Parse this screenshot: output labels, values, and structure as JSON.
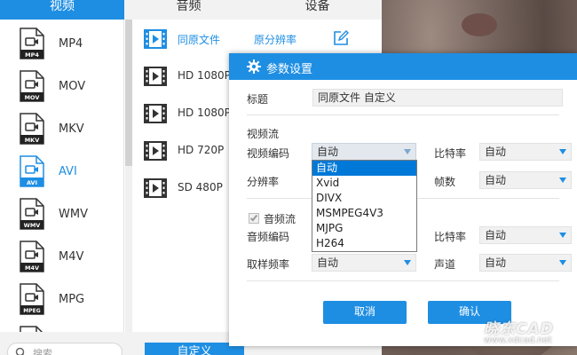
{
  "tabs": [
    {
      "label": "视频"
    },
    {
      "label": "音频"
    },
    {
      "label": "设备"
    }
  ],
  "formats": [
    {
      "label": "MP4",
      "badge": "MP4"
    },
    {
      "label": "MOV",
      "badge": "MOV"
    },
    {
      "label": "MKV",
      "badge": "MKV"
    },
    {
      "label": "AVI",
      "badge": "AVI"
    },
    {
      "label": "WMV",
      "badge": "WMV"
    },
    {
      "label": "M4V",
      "badge": "M4V"
    },
    {
      "label": "MPG",
      "badge": "MPEG"
    }
  ],
  "selected_format": "AVI",
  "resolutions": [
    {
      "name": "同原文件",
      "quality": "原分辨率"
    },
    {
      "name": "HD 1080P",
      "quality": ""
    },
    {
      "name": "HD 1080P",
      "quality": ""
    },
    {
      "name": "HD 720P",
      "quality": ""
    },
    {
      "name": "SD 480P",
      "quality": ""
    }
  ],
  "bottom": {
    "search_placeholder": "搜索",
    "custom_label": "自定义"
  },
  "watermark": {
    "logo": "晓东CAD",
    "url": "www.xdcad.net"
  },
  "dialog": {
    "title": "参数设置",
    "name_label": "标题",
    "name_value": "同原文件 自定义",
    "video_section": "视频流",
    "video_codec_label": "视频编码",
    "video_codec_value": "自动",
    "bitrate_label": "比特率",
    "bitrate_value": "自动",
    "resolution_label": "分辨率",
    "framerate_label": "帧数",
    "framerate_value": "自动",
    "audio_section": "音频流",
    "audio_enabled": true,
    "audio_codec_label": "音频编码",
    "audio_bitrate_label": "比特率",
    "audio_bitrate_value": "自动",
    "samplerate_label": "取样频率",
    "samplerate_value": "自动",
    "channel_label": "声道",
    "channel_value": "自动",
    "cancel_label": "取消",
    "ok_label": "确认"
  },
  "codec_dropdown": {
    "options": [
      "自动",
      "Xvid",
      "DIVX",
      "MSMPEG4V3",
      "MJPG",
      "H264"
    ],
    "highlighted": "自动"
  },
  "colors": {
    "accent": "#1e8ee3",
    "highlight": "#0078d7"
  }
}
